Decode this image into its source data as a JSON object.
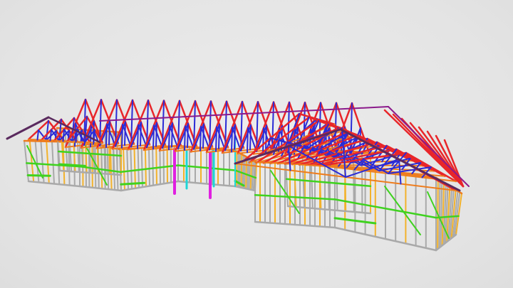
{
  "viewer": {
    "background": "#e6e6e6"
  },
  "model": {
    "colors": {
      "roof_truss_chord": "#e8262a",
      "roof_truss_web": "#2b2bd6",
      "top_plate": "#ee7d1e",
      "wall_stud": "#a9a9a9",
      "wall_stud_alt": "#f2b22c",
      "nogging": "#3fd21f",
      "fascia": "#5a2a5e",
      "post_magenta": "#e020e0",
      "post_cyan": "#1fd6d6",
      "truss_ridge": "#8b1a8b"
    }
  }
}
